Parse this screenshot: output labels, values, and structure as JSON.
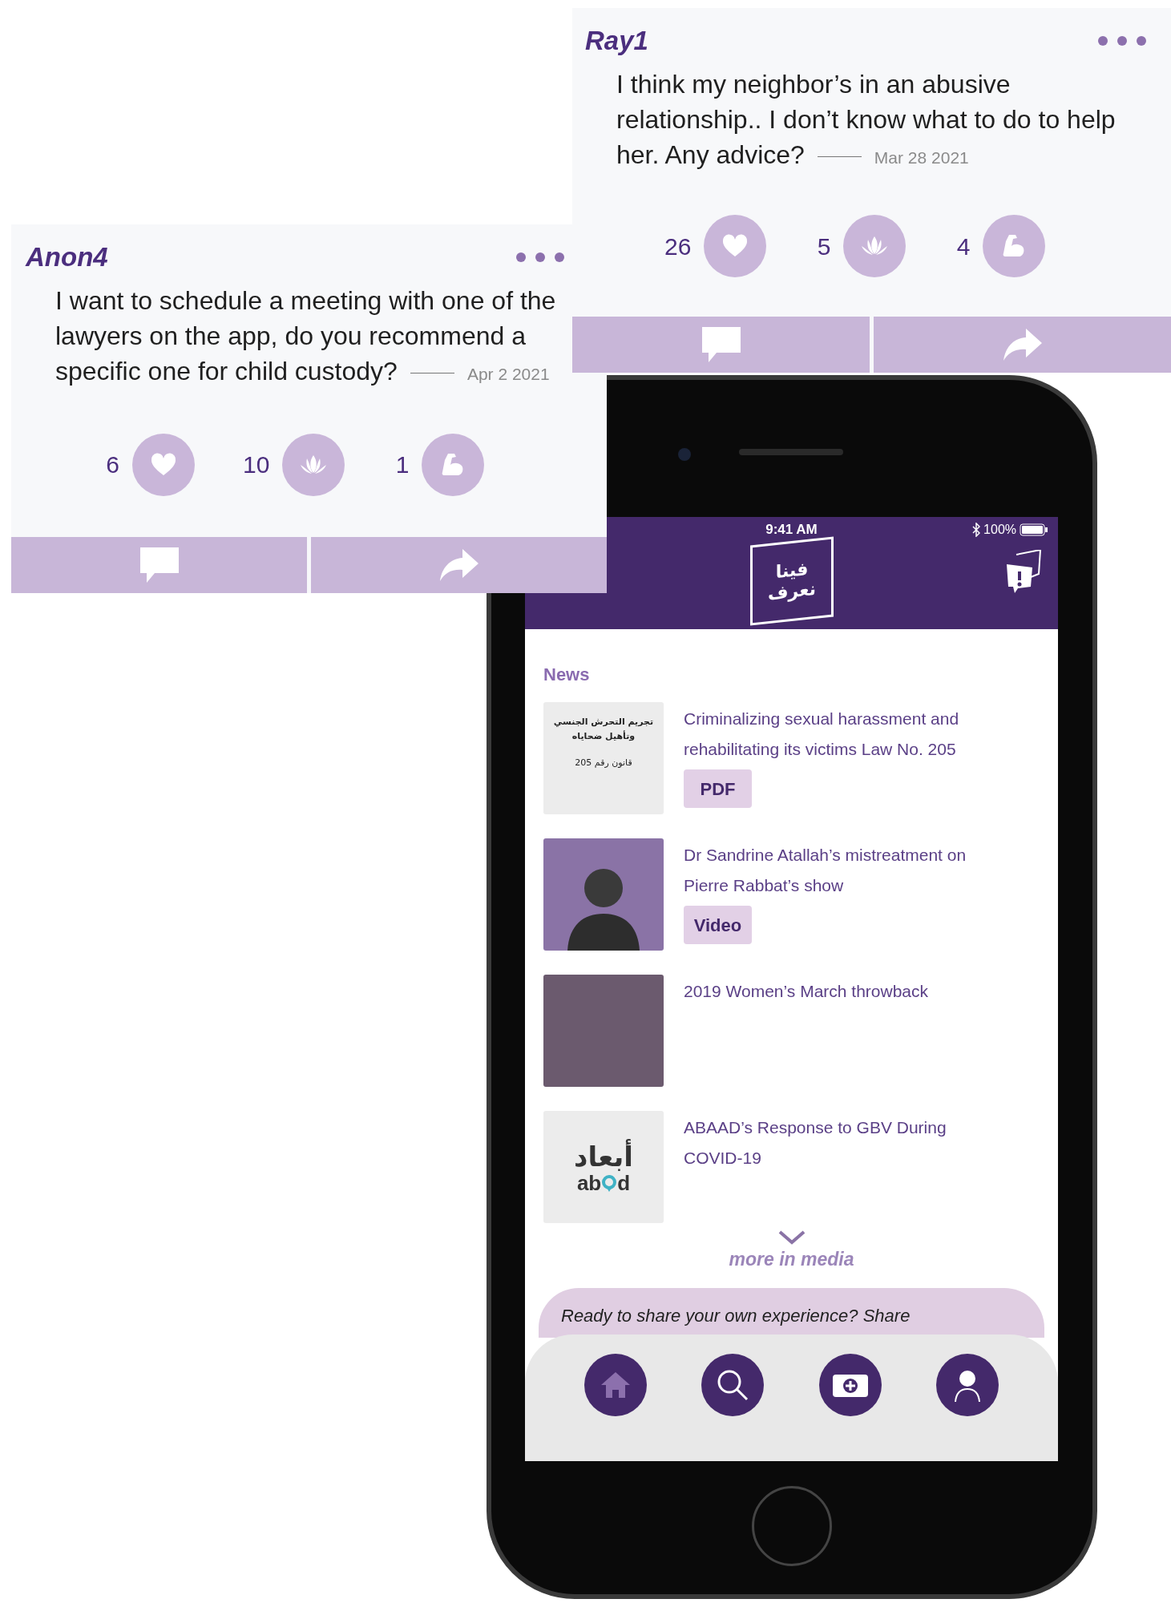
{
  "posts": [
    {
      "author": "Ray1",
      "body": "I think my neighbor’s in an abusive relationship.. I don’t know what to do to help her. Any advice?",
      "date": "Mar 28 2021",
      "reactions": [
        {
          "kind": "heart",
          "count": "26"
        },
        {
          "kind": "lotus",
          "count": "5"
        },
        {
          "kind": "strength",
          "count": "4"
        }
      ]
    },
    {
      "author": "Anon4",
      "body": "I want to schedule a meeting with one of the lawyers on the app, do you recommend a specific one for child custody?",
      "date": "Apr 2 2021",
      "reactions": [
        {
          "kind": "heart",
          "count": "6"
        },
        {
          "kind": "lotus",
          "count": "10"
        },
        {
          "kind": "strength",
          "count": "1"
        }
      ]
    }
  ],
  "phone": {
    "status_bar": {
      "time": "9:41 AM",
      "battery": "100%"
    },
    "logo": [
      "فينا",
      "نعرف"
    ],
    "news": {
      "title": "News",
      "items": [
        {
          "thumbnail": {
            "kind": "document",
            "lines": [
              "تجريم التحرش الجنسي",
              "وتأهيل ضحاياه",
              "قانون رقم 205"
            ]
          },
          "title": "Criminalizing sexual harassment and rehabilitating its victims Law No. 205",
          "badge": "PDF"
        },
        {
          "thumbnail": {
            "kind": "portrait"
          },
          "title": "Dr Sandrine Atallah’s mistreatment on Pierre Rabbat’s show",
          "badge": "Video"
        },
        {
          "thumbnail": {
            "kind": "photo"
          },
          "title": "2019 Women’s March throwback"
        },
        {
          "thumbnail": {
            "kind": "logo",
            "lines": [
              "أبعاد",
              "ab",
              "d"
            ]
          },
          "title": "ABAAD’s Response to GBV During COVID-19"
        }
      ]
    },
    "more_link": "more in media",
    "share_prompt": "Ready to share your own experience? Share",
    "nav": [
      {
        "kind": "home",
        "selected": true
      },
      {
        "kind": "search",
        "selected": false
      },
      {
        "kind": "add",
        "selected": false
      },
      {
        "kind": "profile",
        "selected": false
      }
    ]
  }
}
